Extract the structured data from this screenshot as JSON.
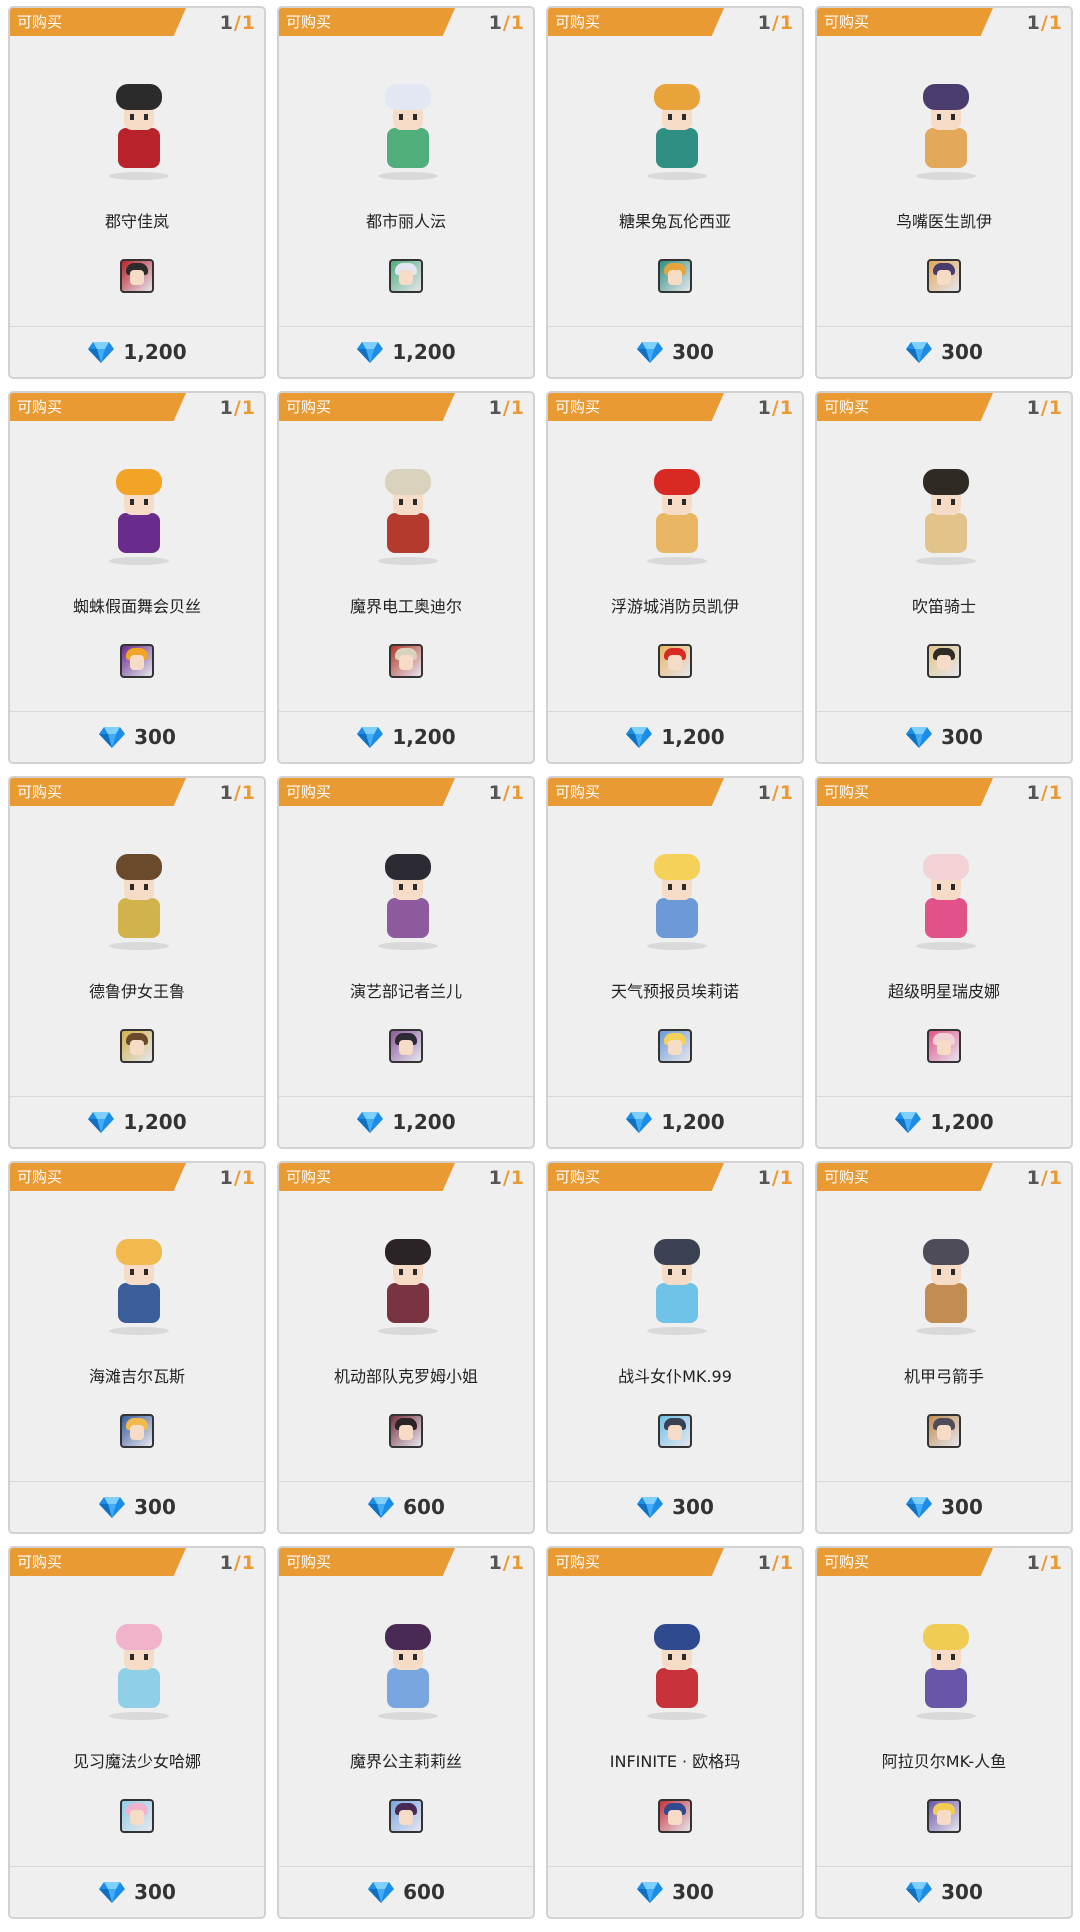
{
  "badge_label": "可购买",
  "count_sep": "/",
  "items": [
    {
      "name": "郡守佳岚",
      "price": "1,200",
      "bought": "1",
      "limit": "1",
      "colors": [
        "#2b2b2b",
        "#b8232b"
      ]
    },
    {
      "name": "都市丽人沄",
      "price": "1,200",
      "bought": "1",
      "limit": "1",
      "colors": [
        "#e3e6f3",
        "#4fae7c"
      ]
    },
    {
      "name": "糖果兔瓦伦西亚",
      "price": "300",
      "bought": "1",
      "limit": "1",
      "colors": [
        "#e8a43a",
        "#2f8f83"
      ]
    },
    {
      "name": "鸟嘴医生凯伊",
      "price": "300",
      "bought": "1",
      "limit": "1",
      "colors": [
        "#4a3d6e",
        "#e3a85a"
      ]
    },
    {
      "name": "蜘蛛假面舞会贝丝",
      "price": "300",
      "bought": "1",
      "limit": "1",
      "colors": [
        "#f2a427",
        "#6a2c8c"
      ]
    },
    {
      "name": "魔界电工奥迪尔",
      "price": "1,200",
      "bought": "1",
      "limit": "1",
      "colors": [
        "#d9d2bd",
        "#b43a2e"
      ]
    },
    {
      "name": "浮游城消防员凯伊",
      "price": "1,200",
      "bought": "1",
      "limit": "1",
      "colors": [
        "#d82a23",
        "#e9b763"
      ]
    },
    {
      "name": "吹笛骑士",
      "price": "300",
      "bought": "1",
      "limit": "1",
      "colors": [
        "#2f2a24",
        "#e2c48a"
      ]
    },
    {
      "name": "德鲁伊女王鲁",
      "price": "1,200",
      "bought": "1",
      "limit": "1",
      "colors": [
        "#6b4a2c",
        "#d2b24a"
      ]
    },
    {
      "name": "演艺部记者兰儿",
      "price": "1,200",
      "bought": "1",
      "limit": "1",
      "colors": [
        "#2c2a33",
        "#8d5a9e"
      ]
    },
    {
      "name": "天气预报员埃莉诺",
      "price": "1,200",
      "bought": "1",
      "limit": "1",
      "colors": [
        "#f4d259",
        "#6b9ad6"
      ]
    },
    {
      "name": "超级明星瑞皮娜",
      "price": "1,200",
      "bought": "1",
      "limit": "1",
      "colors": [
        "#f3d2d6",
        "#e2528a"
      ]
    },
    {
      "name": "海滩吉尔瓦斯",
      "price": "300",
      "bought": "1",
      "limit": "1",
      "colors": [
        "#f1b94e",
        "#3a5e9a"
      ]
    },
    {
      "name": "机动部队克罗姆小姐",
      "price": "600",
      "bought": "1",
      "limit": "1",
      "colors": [
        "#2a2426",
        "#7a3340"
      ]
    },
    {
      "name": "战斗女仆MK.99",
      "price": "300",
      "bought": "1",
      "limit": "1",
      "colors": [
        "#3a4152",
        "#6fc2e8"
      ]
    },
    {
      "name": "机甲弓箭手",
      "price": "300",
      "bought": "1",
      "limit": "1",
      "colors": [
        "#4d4c58",
        "#c28d52"
      ]
    },
    {
      "name": "见习魔法少女哈娜",
      "price": "300",
      "bought": "1",
      "limit": "1",
      "colors": [
        "#f1b3cb",
        "#8fd0e6"
      ]
    },
    {
      "name": "魔界公主莉莉丝",
      "price": "600",
      "bought": "1",
      "limit": "1",
      "colors": [
        "#4a2a55",
        "#7aa6e0"
      ]
    },
    {
      "name": "INFINITE · 欧格玛",
      "price": "300",
      "bought": "1",
      "limit": "1",
      "colors": [
        "#2f4a8f",
        "#c8323a"
      ]
    },
    {
      "name": "阿拉贝尔MK-人鱼",
      "price": "300",
      "bought": "1",
      "limit": "1",
      "colors": [
        "#f0cd52",
        "#6a56a8"
      ]
    }
  ]
}
